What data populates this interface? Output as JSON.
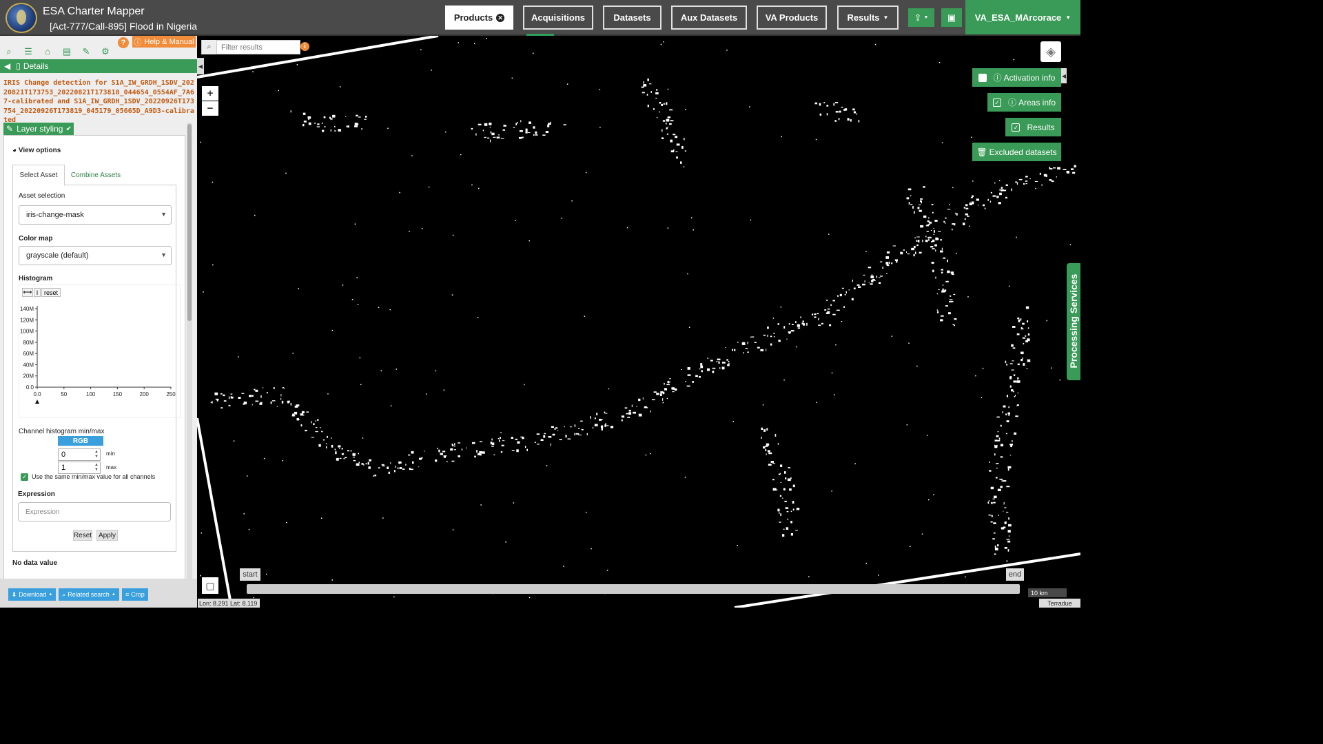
{
  "header": {
    "app_title": "ESA Charter Mapper",
    "activation_title": "[Act-777/Call-895] Flood in Nigeria",
    "nav": {
      "products": "Products",
      "acquisitions": "Acquisitions",
      "datasets": "Datasets",
      "aux_datasets": "Aux Datasets",
      "va_products": "VA Products",
      "results": "Results"
    },
    "user": "VA_ESA_MArcorace"
  },
  "left_panel": {
    "help_label": "Help & Manual",
    "details_label": "Details",
    "product_title": "IRIS Change detection for S1A_IW_GRDH_1SDV_20220821T173753_20220821T173818_044654_0554AF_7A67-calibrated and S1A_IW_GRDH_1SDV_20220926T173754_20220926T173819_045179_05665D_A9D3-calibrated",
    "layer_styling": "Layer styling",
    "view_options": "View options",
    "tabs": {
      "select": "Select Asset",
      "combine": "Combine Assets"
    },
    "asset_selection_label": "Asset selection",
    "asset_selection_value": "iris-change-mask",
    "color_map_label": "Color map",
    "color_map_value": "grayscale (default)",
    "histogram_label": "Histogram",
    "histogram_reset": "reset",
    "histogram": {
      "y_ticks": [
        "140M",
        "120M",
        "100M",
        "80M",
        "60M",
        "40M",
        "20M",
        "0.0"
      ],
      "x_ticks": [
        "0.0",
        "50",
        "100",
        "150",
        "200",
        "250"
      ]
    },
    "channel_label": "Channel histogram min/max",
    "rgb_label": "RGB",
    "min_value": "0",
    "max_value": "1",
    "min_label": "min",
    "max_label": "max",
    "same_minmax_label": "Use the same min/max value for all channels",
    "expression_label": "Expression",
    "expression_placeholder": "Expression",
    "reset_label": "Reset",
    "apply_label": "Apply",
    "no_data_label": "No data value",
    "bottom": {
      "download": "Download",
      "related": "Related search",
      "crop": "Crop"
    }
  },
  "map": {
    "filter_placeholder": "Filter results",
    "activation_info": "Activation info",
    "areas_info": "Areas info",
    "results": "Results",
    "excluded": "Excluded datasets",
    "processing_services": "Processing Services",
    "timeline_start": "start",
    "timeline_end": "end",
    "scale": "10 km",
    "coords": "Lon: 8.291 Lat: 8.119",
    "attribution": "Terradue"
  },
  "colors": {
    "accent": "#3a9a57",
    "orange": "#f08c3a",
    "blue": "#3aa0dd"
  }
}
